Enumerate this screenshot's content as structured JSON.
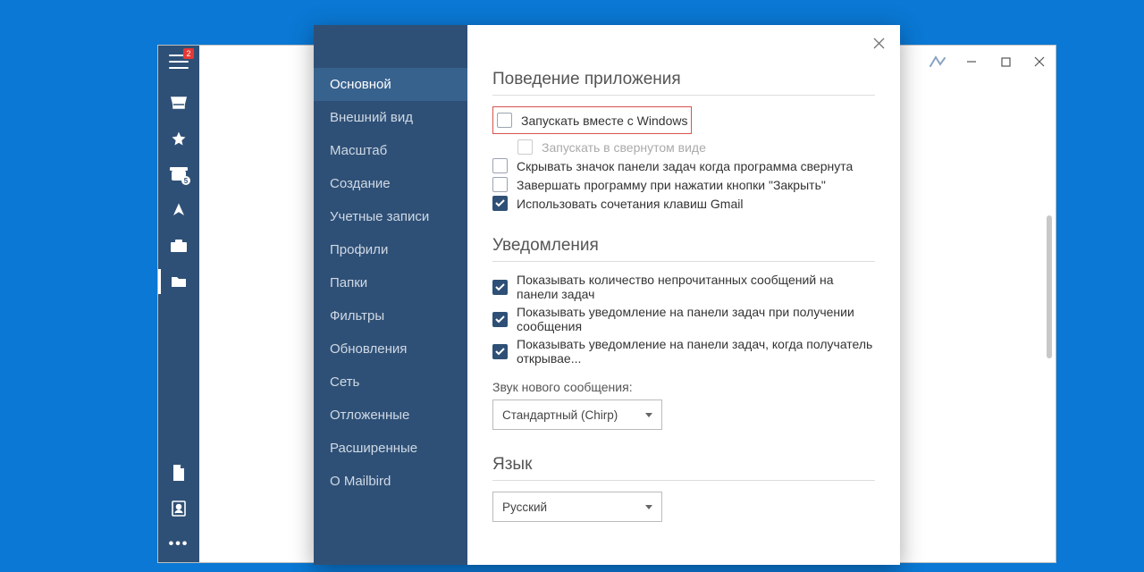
{
  "sidebar": {
    "badge": "2"
  },
  "titlebar": {
    "min": "—",
    "max": "▢",
    "close": "✕"
  },
  "settings": {
    "nav": [
      "Основной",
      "Внешний вид",
      "Масштаб",
      "Создание",
      "Учетные записи",
      "Профили",
      "Папки",
      "Фильтры",
      "Обновления",
      "Сеть",
      "Отложенные",
      "Расширенные",
      "О Mailbird"
    ],
    "sections": {
      "behavior": {
        "title": "Поведение приложения",
        "items": {
          "launch_with_windows": "Запускать вместе с Windows",
          "launch_minimized": "Запускать в свернутом виде",
          "hide_tray": "Скрывать значок панели задач когда программа свернута",
          "exit_on_close": "Завершать программу при нажатии кнопки \"Закрыть\"",
          "gmail_shortcuts": "Использовать сочетания клавиш Gmail"
        }
      },
      "notifications": {
        "title": "Уведомления",
        "items": {
          "show_count": "Показывать количество непрочитанных сообщений на панели задач",
          "show_new": "Показывать уведомление на панели задач при получении сообщения",
          "show_open": "Показывать уведомление на панели задач, когда получатель открывае..."
        },
        "sound_label": "Звук нового сообщения:",
        "sound_value": "Стандартный (Chirp)"
      },
      "language": {
        "title": "Язык",
        "value": "Русский"
      }
    }
  }
}
